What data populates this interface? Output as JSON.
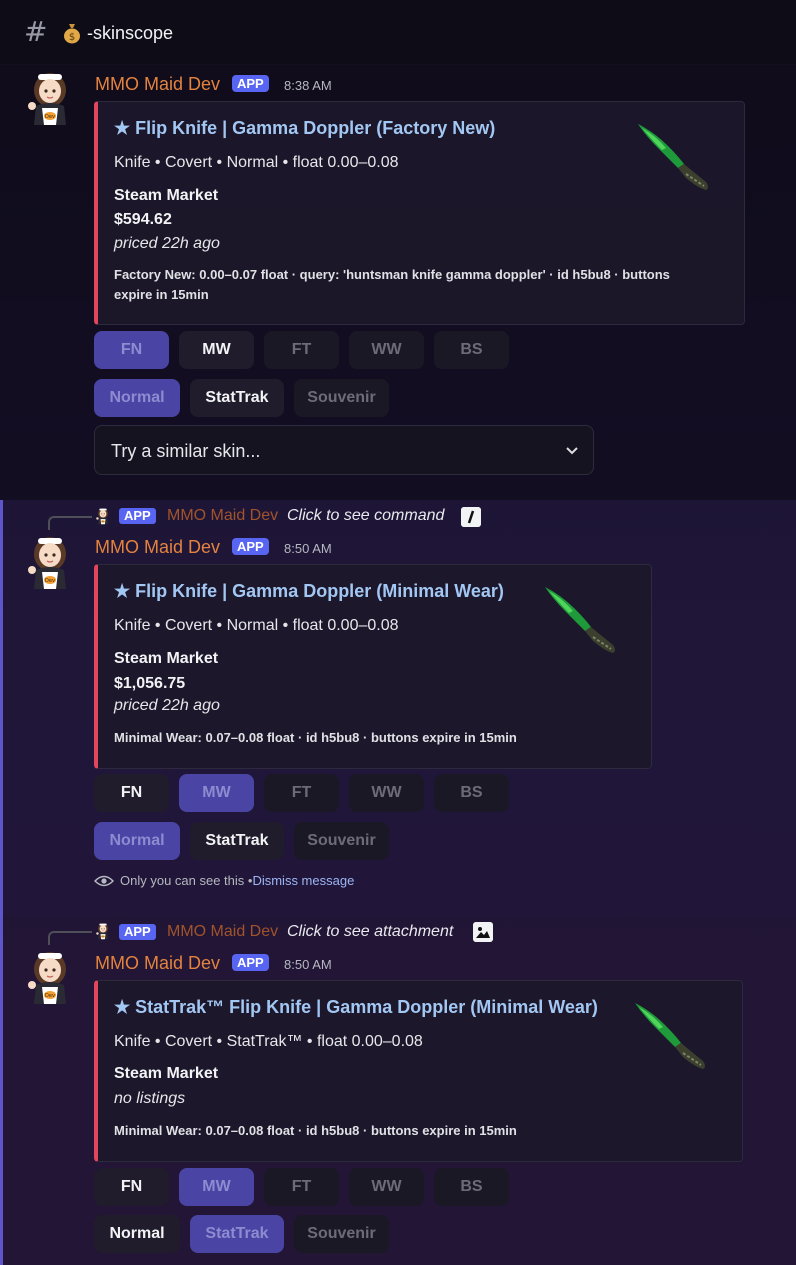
{
  "channel": {
    "icon": "moneybag-icon",
    "name": "-skinscope"
  },
  "bot": {
    "name": "MMO Maid Dev",
    "badge": "APP",
    "avatar": "maid-avatar"
  },
  "messages": [
    {
      "time": "8:38 AM",
      "embed": {
        "title": "★ Flip Knife | Gamma Doppler (Factory New)",
        "desc": "Knife • Covert • Normal • float 0.00–0.08",
        "field_name": "Steam Market",
        "price": "$594.62",
        "priced": "priced 22h ago",
        "footer_line1": "Factory New: 0.00–0.07 float · query: 'huntsman knife gamma doppler' · id h5bu8 · buttons",
        "footer_line2": "expire in 15min"
      },
      "size_buttons": [
        "FN",
        "MW",
        "FT",
        "WW",
        "BS"
      ],
      "variant_buttons": [
        "Normal",
        "StatTrak",
        "Souvenir"
      ],
      "select_placeholder": "Try a similar skin..."
    },
    {
      "reply": {
        "badge": "APP",
        "author": "MMO Maid Dev",
        "text": "Click to see command"
      },
      "time": "8:50 AM",
      "embed": {
        "title": "★ Flip Knife | Gamma Doppler (Minimal Wear)",
        "desc": "Knife • Covert • Normal • float 0.00–0.08",
        "field_name": "Steam Market",
        "price": "$1,056.75",
        "priced": "priced 22h ago",
        "footer": "Minimal Wear: 0.07–0.08 float · id h5bu8 · buttons expire in 15min"
      },
      "size_buttons": [
        "FN",
        "MW",
        "FT",
        "WW",
        "BS"
      ],
      "variant_buttons": [
        "Normal",
        "StatTrak",
        "Souvenir"
      ],
      "ephemeral": {
        "text": "Only you can see this • ",
        "dismiss": "Dismiss message"
      }
    },
    {
      "reply": {
        "badge": "APP",
        "author": "MMO Maid Dev",
        "text": "Click to see attachment"
      },
      "time": "8:50 AM",
      "embed": {
        "title": "★ StatTrak™ Flip Knife | Gamma Doppler (Minimal Wear)",
        "desc": "Knife • Covert • StatTrak™ • float 0.00–0.08",
        "field_name": "Steam Market",
        "listings": "no listings",
        "footer": "Minimal Wear: 0.07–0.08 float · id h5bu8 · buttons expire in 15min"
      },
      "size_buttons": [
        "FN",
        "MW",
        "FT",
        "WW",
        "BS"
      ],
      "variant_buttons": [
        "Normal",
        "StatTrak",
        "Souvenir"
      ]
    }
  ],
  "colors": {
    "accent_bar": "#e2455c",
    "title_link": "#a3c7f3",
    "author": "#e3833f",
    "app_badge": "#5865f2"
  }
}
